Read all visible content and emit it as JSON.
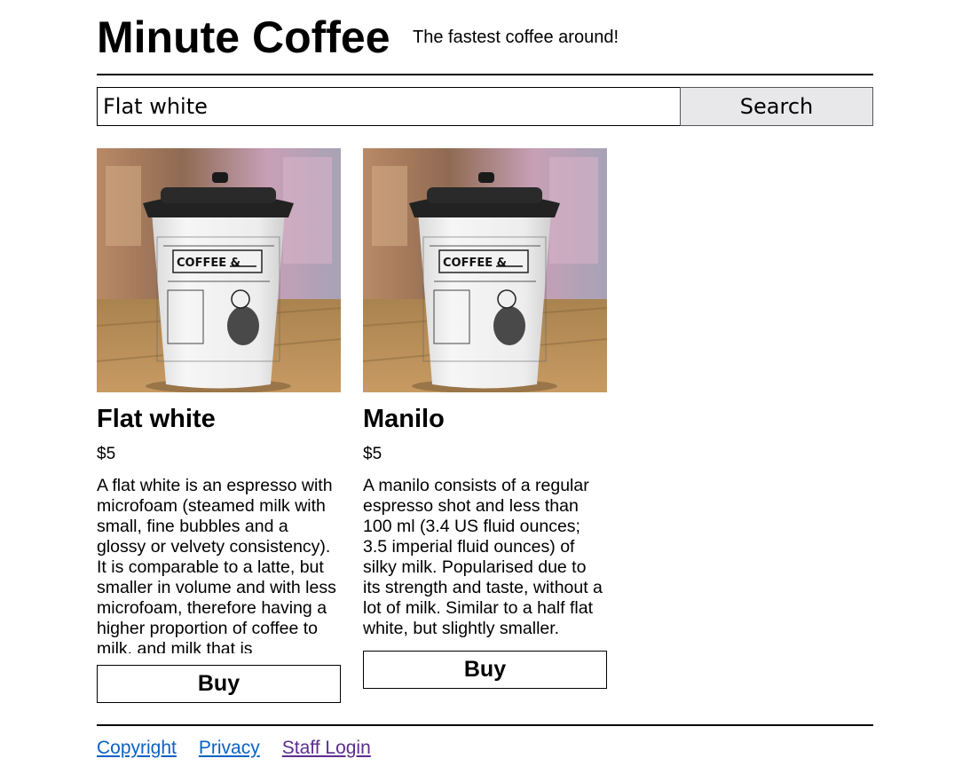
{
  "header": {
    "site_title": "Minute Coffee",
    "tagline": "The fastest coffee around!"
  },
  "search": {
    "value": "Flat white",
    "button_label": "Search"
  },
  "products": [
    {
      "title": "Flat white",
      "price": "$5",
      "description": "A flat white is an espresso with microfoam (steamed milk with small, fine bubbles and a glossy or velvety consistency). It is comparable to a latte, but smaller in volume and with less microfoam, therefore having a higher proportion of coffee to milk, and milk that is",
      "image": "coffee-cup-photo",
      "buy_label": "Buy"
    },
    {
      "title": "Manilo",
      "price": "$5",
      "description": "A manilo consists of a regular espresso shot and less than 100 ml (3.4 US fluid ounces; 3.5 imperial fluid ounces) of silky milk. Popularised due to its strength and taste, without a lot of milk. Similar to a half flat white, but slightly smaller.",
      "image": "coffee-cup-photo",
      "buy_label": "Buy"
    }
  ],
  "cup_print": {
    "sign_text": "COFFEE &"
  },
  "footer": {
    "links": [
      {
        "label": "Copyright",
        "visited": false
      },
      {
        "label": "Privacy",
        "visited": false
      },
      {
        "label": "Staff Login",
        "visited": true
      }
    ]
  },
  "colors": {
    "link": "#0b62c4",
    "link_visited": "#5b2d90",
    "search_button_bg": "#e8e8eb",
    "text": "#000000"
  }
}
